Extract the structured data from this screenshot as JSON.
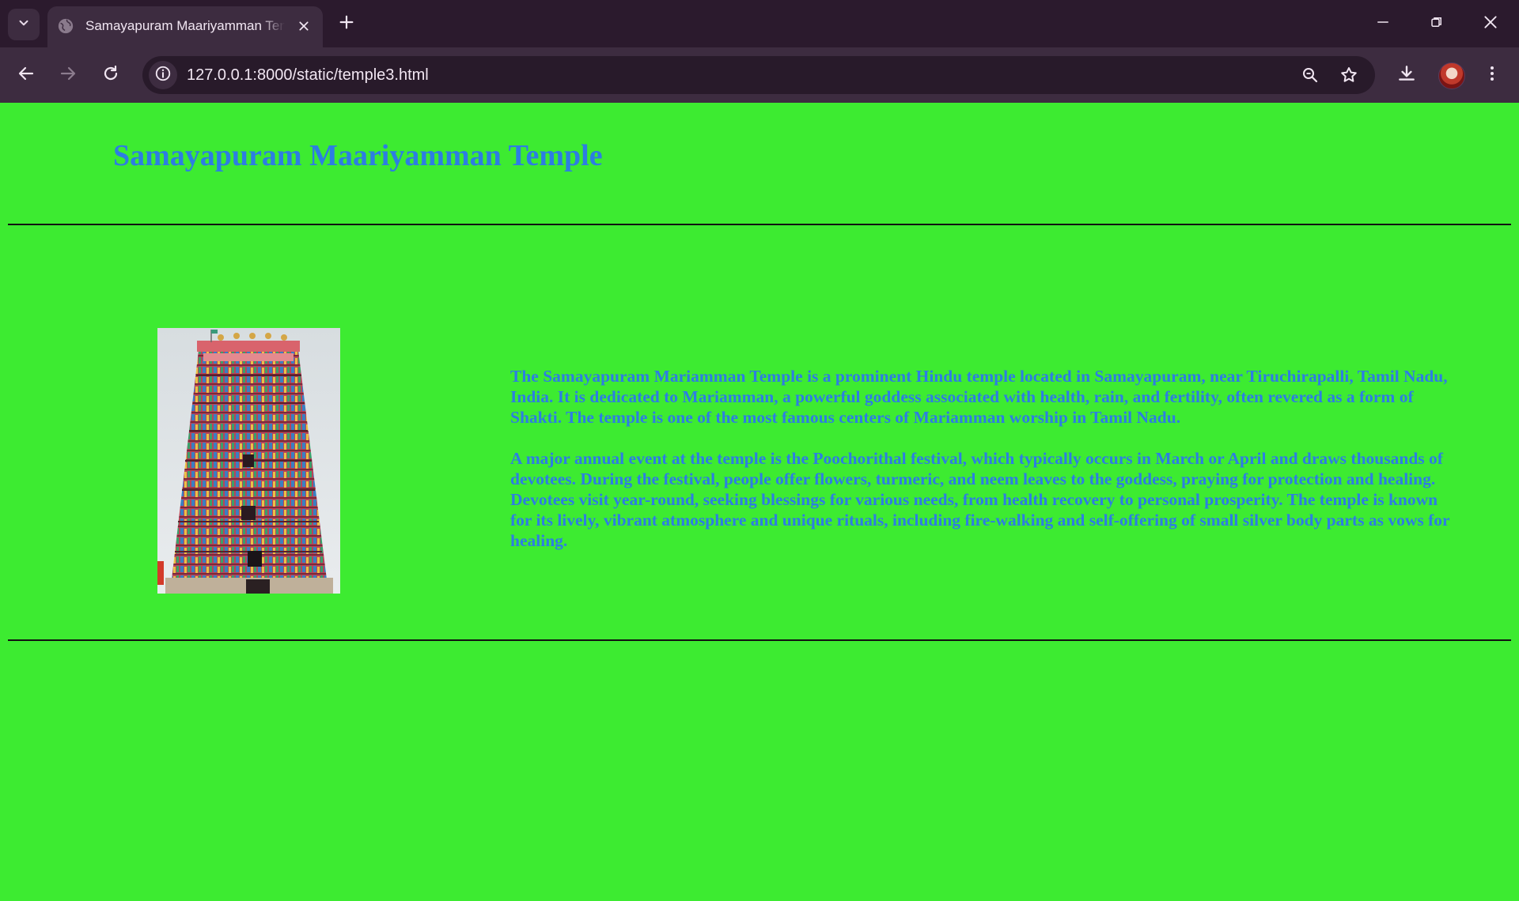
{
  "browser": {
    "tab": {
      "title": "Samayapuram Maariyamman Temple",
      "favicon": "globe-icon"
    },
    "address_bar": {
      "url": "127.0.0.1:8000/static/temple3.html",
      "site_info_icon": "info-icon"
    },
    "toolbar_icons": [
      "back-icon",
      "forward-icon",
      "reload-icon",
      "zoom-icon",
      "bookmark-star-icon",
      "download-icon",
      "avatar",
      "menu-icon"
    ],
    "window_controls": [
      "minimize-icon",
      "restore-icon",
      "close-icon"
    ]
  },
  "page": {
    "background_color": "#3deb31",
    "text_color": "#2d7de3",
    "heading": "Samayapuram Maariyamman Temple",
    "image": {
      "subject": "temple gopuram tower"
    },
    "paragraphs": [
      "The Samayapuram Mariamman Temple is a prominent Hindu temple located in Samayapuram, near Tiruchirapalli, Tamil Nadu, India. It is dedicated to Mariamman, a powerful goddess associated with health, rain, and fertility, often revered as a form of Shakti. The temple is one of the most famous centers of Mariamman worship in Tamil Nadu.",
      "A major annual event at the temple is the Poochorithal festival, which typically occurs in March or April and draws thousands of devotees. During the festival, people offer flowers, turmeric, and neem leaves to the goddess, praying for protection and healing. Devotees visit year-round, seeking blessings for various needs, from health recovery to personal prosperity. The temple is known for its lively, vibrant atmosphere and unique rituals, including fire-walking and self-offering of small silver body parts as vows for healing."
    ]
  }
}
